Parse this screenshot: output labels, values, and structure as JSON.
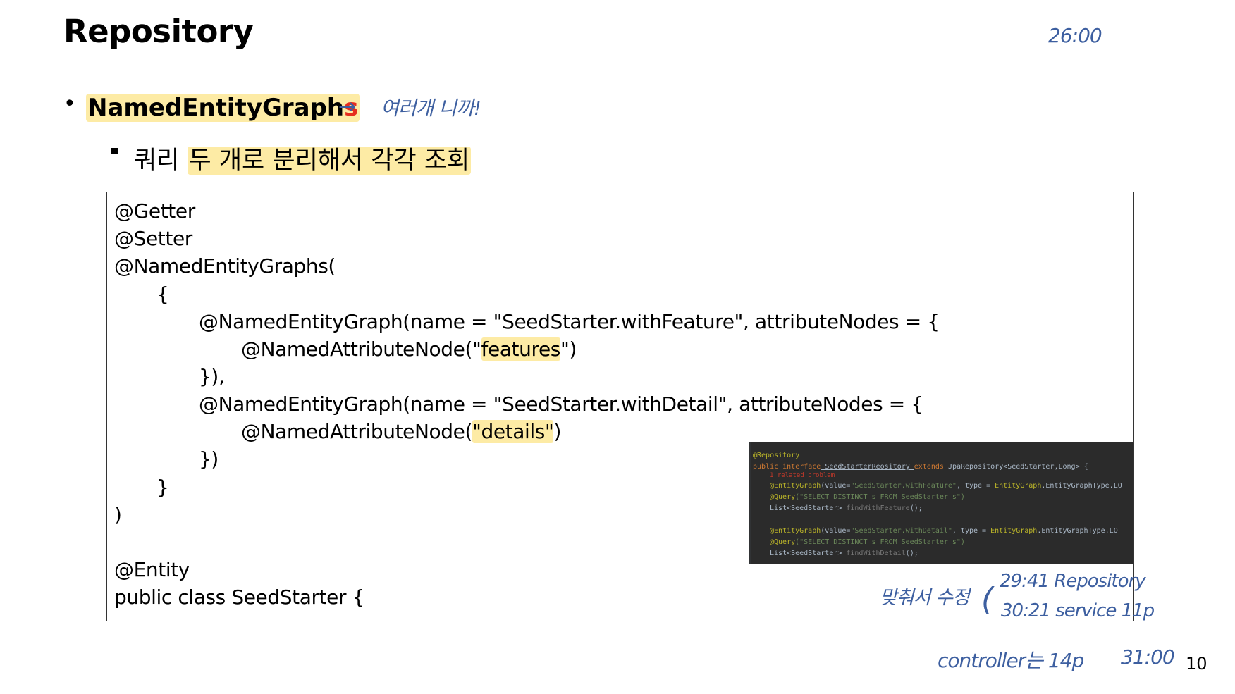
{
  "slide": {
    "title": "Repository",
    "page_number": "10",
    "bullet1": {
      "prefix": "NamedEntityGraph",
      "suffix": "s"
    },
    "bullet2": {
      "lead": "쿼리 ",
      "highlight": "두 개로 분리해서 각각 조회"
    }
  },
  "code": {
    "lines": [
      {
        "pre": "@Getter",
        "hl": "",
        "post": ""
      },
      {
        "pre": "@Setter",
        "hl": "",
        "post": ""
      },
      {
        "pre": "@NamedEntityGraphs(",
        "hl": "",
        "post": ""
      },
      {
        "pre": "{",
        "hl": "",
        "post": ""
      },
      {
        "pre": "@NamedEntityGraph(name = \"SeedStarter.withFeature\", attributeNodes = {",
        "hl": "",
        "post": ""
      },
      {
        "pre": "@NamedAttributeNode(\"",
        "hl": "features",
        "post": "\")"
      },
      {
        "pre": "}),",
        "hl": "",
        "post": ""
      },
      {
        "pre": "@NamedEntityGraph(name = \"SeedStarter.withDetail\", attributeNodes = {",
        "hl": "",
        "post": ""
      },
      {
        "pre": "@NamedAttributeNode(",
        "hl": "\"details\"",
        "post": ")"
      },
      {
        "pre": "})",
        "hl": "",
        "post": ""
      },
      {
        "pre": "}",
        "hl": "",
        "post": ""
      },
      {
        "pre": ")",
        "hl": "",
        "post": ""
      },
      {
        "pre": "",
        "hl": "",
        "post": ""
      },
      {
        "pre": "@Entity",
        "hl": "",
        "post": ""
      },
      {
        "pre": "public class SeedStarter {",
        "hl": "",
        "post": ""
      }
    ]
  },
  "ide_snippet": {
    "line1": "@Repository",
    "line2_kw": "public interface",
    "line2_name": " SeedStarterReository ",
    "line2_ext": "extends",
    "line2_rest": " JpaRepository<SeedStarter,Long> {",
    "line3": "1 related problem",
    "line4_ann": "@EntityGraph",
    "line4_a": "(value=",
    "line4_str": "\"SeedStarter.withFeature\"",
    "line4_b": ", type = ",
    "line4_c": "EntityGraph",
    "line4_d": ".EntityGraphType.LO",
    "line5_ann": "@Query",
    "line5_str": "(\"SELECT DISTINCT s FROM SeedStarter s\")",
    "line6_a": "List<SeedStarter> ",
    "line6_b": "findWithFeature",
    "line6_c": "();",
    "line7_ann": "@EntityGraph",
    "line7_a": "(value=",
    "line7_str": "\"SeedStarter.withDetail\"",
    "line7_b": ", type = ",
    "line7_c": "EntityGraph",
    "line7_d": ".EntityGraphType.LO",
    "line8_ann": "@Query",
    "line8_str": "(\"SELECT DISTINCT s FROM SeedStarter s\")",
    "line9_a": "List<SeedStarter> ",
    "line9_b": "findWithDetail",
    "line9_c": "();"
  },
  "handwritten": {
    "time_top": "26:00",
    "note_bullet": "여러개 니까!",
    "note_fix": "맞춰서 수정",
    "note_repo": "29:41 Repository",
    "note_service": "30:21 service 11p",
    "note_controller": "controller는 14p",
    "time_bottom": "31:00"
  }
}
